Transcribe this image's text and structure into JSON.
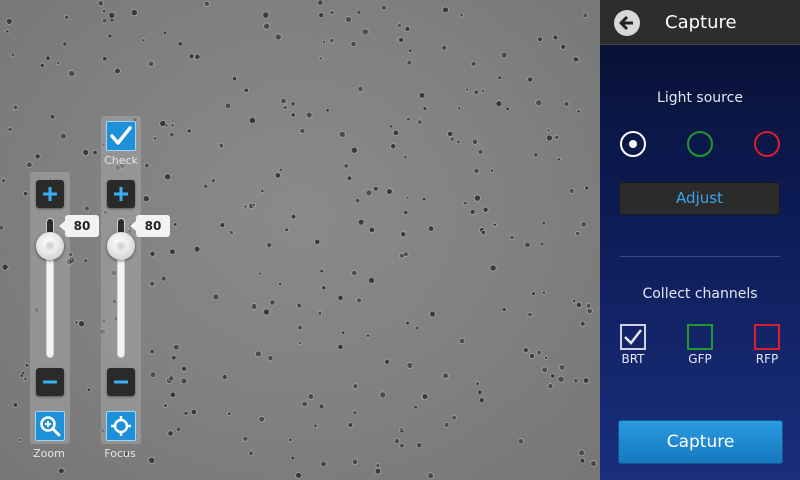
{
  "viewport": {
    "description_icon": "microscope-cells"
  },
  "check": {
    "label": "Check",
    "checked": true
  },
  "zoom": {
    "value": "80",
    "label": "Zoom",
    "level": 0.8
  },
  "focus": {
    "value": "80",
    "label": "Focus",
    "level": 0.8
  },
  "panel": {
    "title": "Capture",
    "light_source_label": "Light source",
    "light_sources": [
      {
        "color": "#ffffff",
        "selected": true
      },
      {
        "color": "#1f9a2f",
        "selected": false
      },
      {
        "color": "#d8202a",
        "selected": false
      }
    ],
    "adjust_label": "Adjust",
    "collect_label": "Collect channels",
    "channels": [
      {
        "name": "BRT",
        "color": "#cfd3df",
        "checked": true
      },
      {
        "name": "GFP",
        "color": "#1f9a2f",
        "checked": false
      },
      {
        "name": "RFP",
        "color": "#d8202a",
        "checked": false
      }
    ],
    "capture_label": "Capture"
  },
  "colors": {
    "accent": "#1e90d8",
    "panel_bg": "#0c1a52"
  }
}
